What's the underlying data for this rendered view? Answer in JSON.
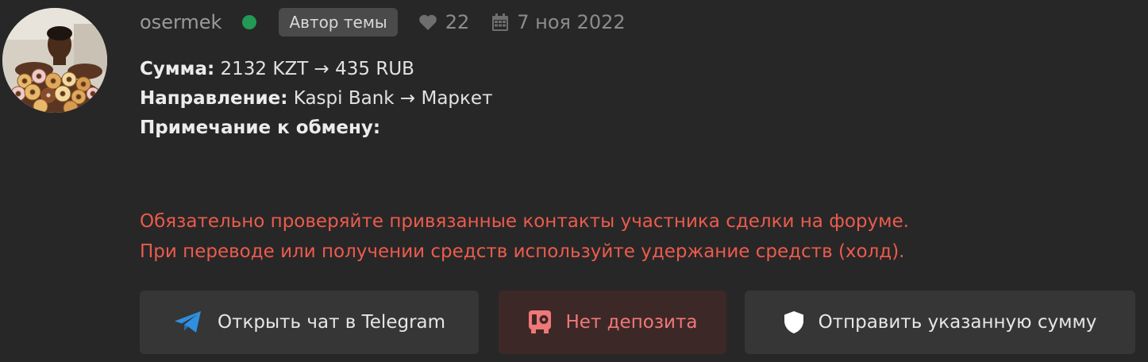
{
  "header": {
    "username": "osermek",
    "status": "online",
    "author_badge": "Автор темы",
    "likes": "22",
    "date": "7 ноя 2022"
  },
  "content": {
    "amount_label": "Сумма:",
    "amount_value": "2132 KZT → 435 RUB",
    "direction_label": "Направление:",
    "direction_value": "Kaspi Bank → Маркет",
    "note_label": "Примечание к обмену:"
  },
  "warning": {
    "line1": "Обязательно проверяйте привязанные контакты участника сделки на форуме.",
    "line2": "При переводе или получении средств используйте удержание средств (холд)."
  },
  "buttons": {
    "telegram": "Открыть чат в Telegram",
    "deposit": "Нет депозита",
    "send": "Отправить указанную сумму"
  },
  "colors": {
    "background": "#272727",
    "online": "#229954",
    "warning": "#ec5b4d",
    "telegram_blue": "#2f8fe0",
    "deposit_red": "#f07878"
  },
  "icons": {
    "online": "online-dot-icon",
    "likes": "heart-icon",
    "date": "calendar-icon",
    "telegram": "telegram-icon",
    "deposit": "deposit-icon",
    "send": "shield-icon"
  }
}
